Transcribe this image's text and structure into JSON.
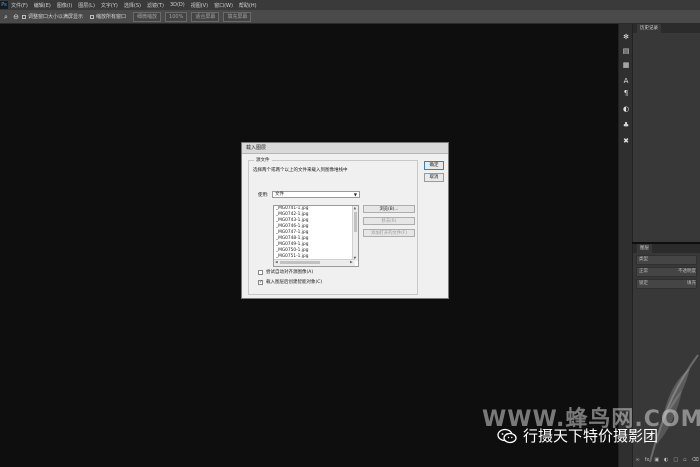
{
  "menubar": {
    "logo": "Ps",
    "items": [
      "文件(F)",
      "编辑(E)",
      "图像(I)",
      "图层(L)",
      "文字(Y)",
      "选择(S)",
      "滤镜(T)",
      "3D(D)",
      "视图(V)",
      "窗口(W)",
      "帮助(H)"
    ]
  },
  "optionsbar": {
    "tool_icon": "zoom-icon",
    "resize_windows": "调整窗口大小以满屏显示",
    "zoom_all": "缩放所有窗口",
    "scrubby_zoom": "细微缩放",
    "actual_pixels": "100%",
    "fit_screen": "适合屏幕",
    "fill_screen": "填充屏幕"
  },
  "panels": {
    "history_tab": "历史记录",
    "layers_tab": "图层",
    "layers_kind": "类型",
    "layers_mode": "正常",
    "layers_opacity": "不透明度",
    "layers_lock": "锁定",
    "layers_fill": "填充"
  },
  "dialog": {
    "title": "载入图层",
    "group_title": "源文件",
    "instruction": "选择两个或两个以上的文件来载入到图像堆栈中",
    "use_label": "使用:",
    "use_value": "文件",
    "files": [
      "_MG0741-1.jpg",
      "_MG0742-1.jpg",
      "_MG0743-1.jpg",
      "_MG0746-1.jpg",
      "_MG0747-1.jpg",
      "_MG0748-1.jpg",
      "_MG0749-1.jpg",
      "_MG0750-1.jpg",
      "_MG0751-1.jpg"
    ],
    "browse_label": "浏览(B)...",
    "remove_label": "移去(R)",
    "add_open_label": "添加打开的文件(F)",
    "ok_label": "确定",
    "cancel_label": "取消",
    "auto_align_label": "尝试自动对齐源图像(A)",
    "auto_align_checked": false,
    "smart_object_label": "载入图层后创建智能对象(C)",
    "smart_object_checked": true
  },
  "watermark": {
    "site": "WWW.蜂鸟网.COM",
    "account": "行摄天下特价摄影团"
  },
  "colors": {
    "canvas": "#0e0e0e",
    "menubar": "#3a3a3a",
    "optionsbar": "#4a4a4a",
    "panel": "#383838",
    "dialog": "#f0f0f0",
    "ps_blue": "#31a8ff"
  }
}
